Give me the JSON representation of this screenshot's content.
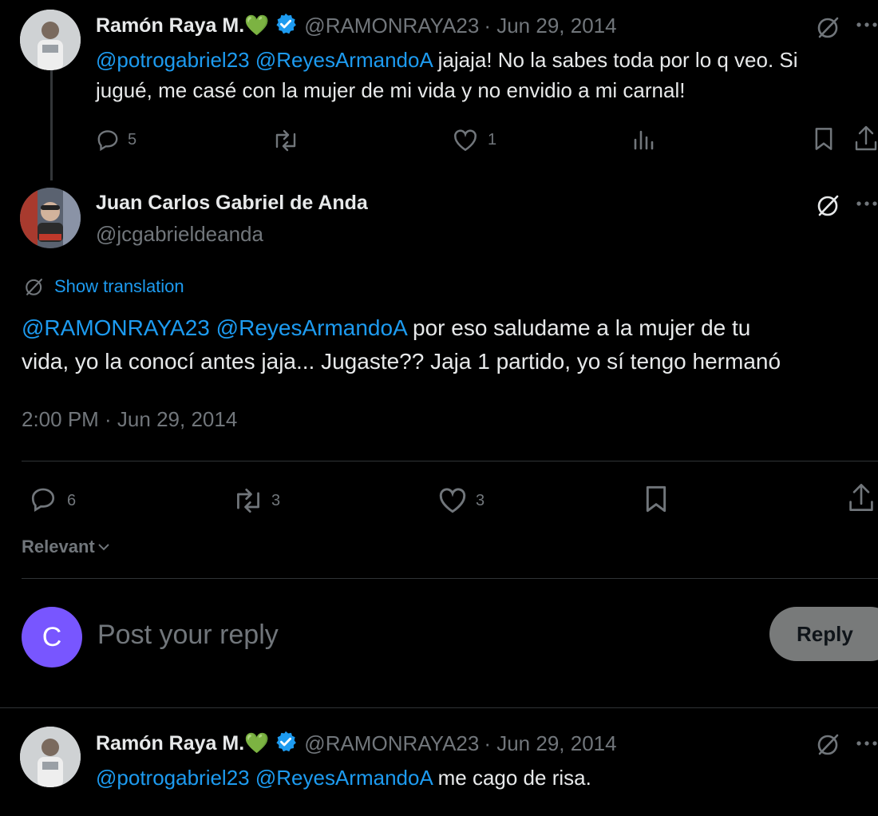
{
  "reply1": {
    "name": "Ramón Raya M.💚",
    "handle": "@RAMONRAYA23",
    "date": "· Jun 29, 2014",
    "mention1": "@potrogabriel23",
    "mention2": "@ReyesArmandoA",
    "text_line1": "jajaja! No la sabes toda por lo q veo. Si",
    "text_line2": "jugué, me casé con la mujer de mi vida y no envidio a mi carnal!",
    "replies": "5",
    "likes": "1"
  },
  "main": {
    "name": "Juan Carlos Gabriel de Anda",
    "handle": "@jcgabrieldeanda",
    "translate_label": "Show translation",
    "mention1": "@RAMONRAYA23",
    "mention2": "@ReyesArmandoA",
    "text_line1": "por eso saludame a la mujer de tu",
    "text_line2": "vida, yo la conocí antes jaja... Jugaste?? Jaja 1 partido, yo sí tengo hermanó",
    "timestamp": "2:00 PM · Jun 29, 2014",
    "replies": "6",
    "reposts": "3",
    "likes": "3"
  },
  "sort": {
    "label": "Relevant"
  },
  "composer": {
    "avatar_letter": "C",
    "placeholder": "Post your reply",
    "reply_button": "Reply"
  },
  "reply2": {
    "name": "Ramón Raya M.💚",
    "handle": "@RAMONRAYA23",
    "date": "· Jun 29, 2014",
    "mention1": "@potrogabriel23",
    "mention2": "@ReyesArmandoA",
    "text": "me cago de risa."
  },
  "colors": {
    "background": "#000000",
    "link": "#1d9bf0",
    "muted": "#71767b",
    "avatar_purple": "#7856ff"
  }
}
